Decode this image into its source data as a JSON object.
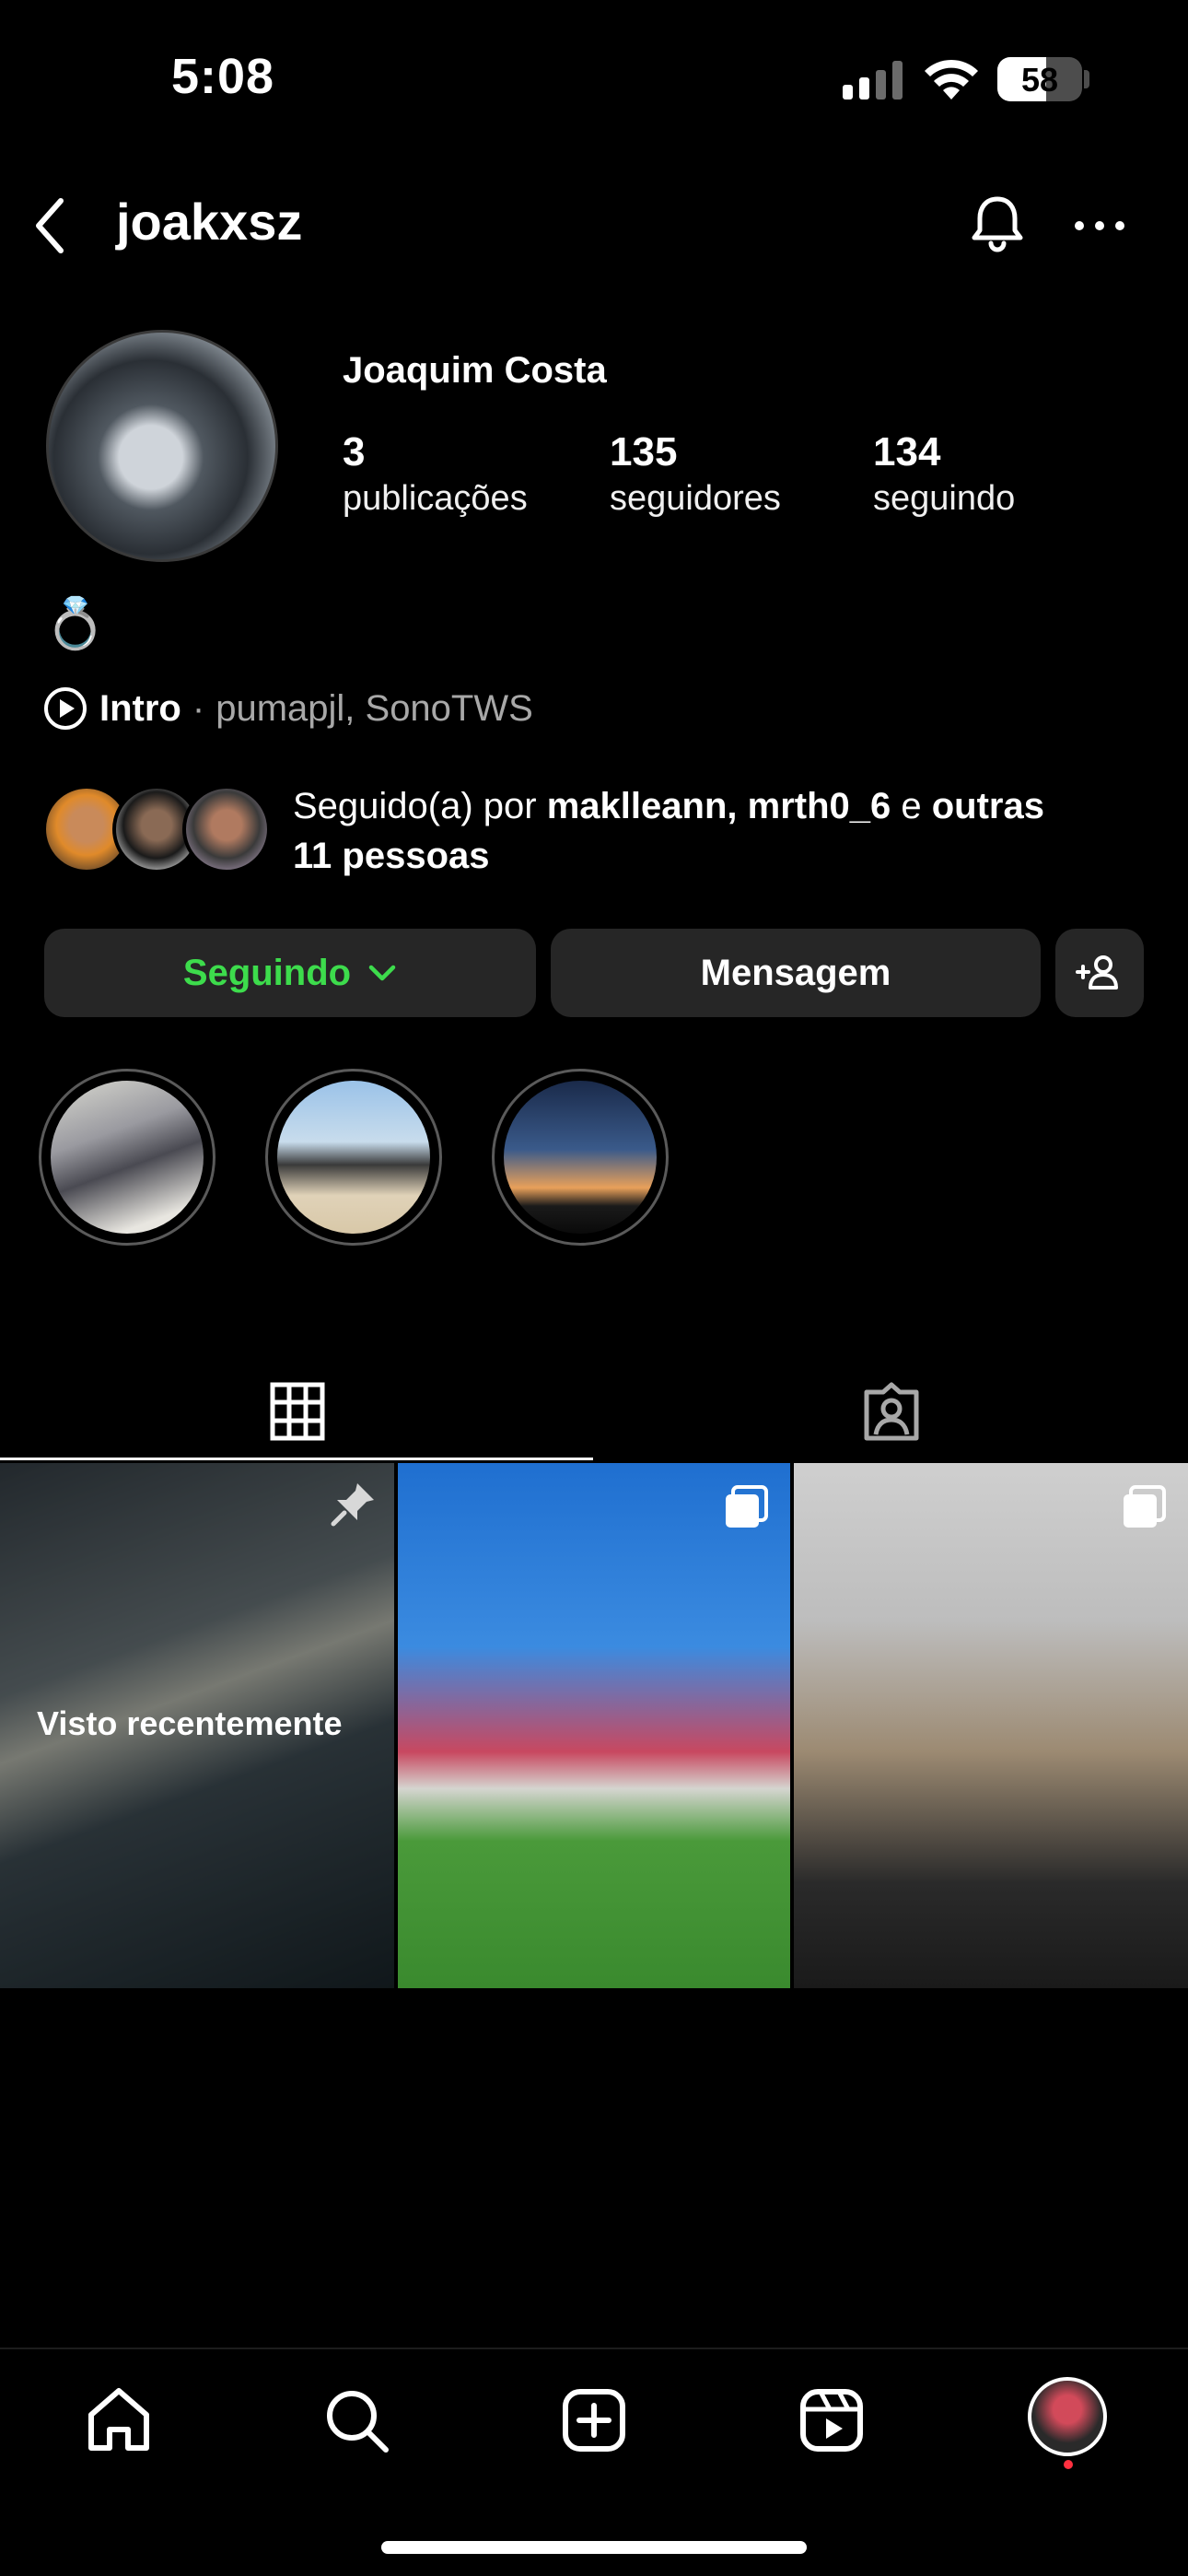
{
  "status_bar": {
    "time": "5:08",
    "battery": "58"
  },
  "header": {
    "username": "joakxsz"
  },
  "profile": {
    "display_name": "Joaquim Costa",
    "stats": [
      {
        "value": "3",
        "label": "publicações"
      },
      {
        "value": "135",
        "label": "seguidores"
      },
      {
        "value": "134",
        "label": "seguindo"
      }
    ],
    "bio_emoji": "💍",
    "intro": {
      "label": "Intro",
      "separator": "·",
      "accounts": "pumapjl, SonoTWS"
    },
    "followed_by": {
      "prefix": "Seguido(a) por ",
      "user1": "maklleann",
      "comma": ", ",
      "user2": "mrth0_6",
      "conj": " e ",
      "others": "outras",
      "line2": "11 pessoas"
    }
  },
  "actions": {
    "following_label": "Seguindo",
    "message_label": "Mensagem"
  },
  "grid": {
    "recent_label": "Visto recentemente"
  },
  "icons": {
    "back": "chevron-left-icon",
    "bell": "bell-icon",
    "more": "more-horizontal-icon",
    "grid_tab": "grid-icon",
    "tagged_tab": "tagged-icon",
    "home": "home-icon",
    "search": "search-icon",
    "create": "plus-square-icon",
    "reels": "reels-icon"
  },
  "colors": {
    "following_green": "#3ddc4c",
    "button_bg": "#262626",
    "notification_dot": "#ff3040"
  }
}
